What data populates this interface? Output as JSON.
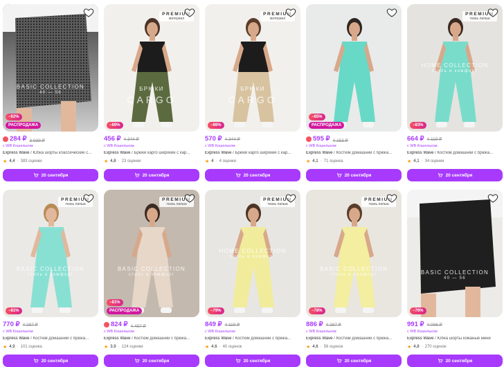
{
  "button_label": "20 сентября",
  "cards": [
    {
      "price": "284 ₽",
      "old": "3 939 ₽",
      "wallet": "с WB Кошельком",
      "brand": "Express Wave",
      "sep": " / ",
      "title": "Юбка шорты классические с...",
      "rating": "4,4",
      "reviews": "383 оценки",
      "discount": "−92%",
      "sale": "РАСПРОДАЖА",
      "dot": true,
      "premium": null,
      "overlay": "BASIC COLLECTION",
      "overlay2": "40 — 56",
      "big": null
    },
    {
      "price": "456 ₽",
      "old": "4 344 ₽",
      "wallet": "с WB Кошельком",
      "brand": "Express Wave",
      "sep": " / ",
      "title": "Брюки карго широкие с кар...",
      "rating": "4,8",
      "reviews": "23 оценки",
      "discount": "−89%",
      "sale": null,
      "dot": false,
      "premium": {
        "l1": "PREMIUM",
        "l2": "материал"
      },
      "overlay": "БРЮКИ",
      "overlay2": null,
      "big": "CARGO"
    },
    {
      "price": "570 ₽",
      "old": "4 344 ₽",
      "wallet": "с WB Кошельком",
      "brand": "Express Wave",
      "sep": " / ",
      "title": "Брюки карго широкие с кар...",
      "rating": "4",
      "reviews": "4 оценки",
      "discount": "−86%",
      "sale": null,
      "dot": false,
      "premium": {
        "l1": "PREMIUM",
        "l2": "материал"
      },
      "overlay": "БРЮКИ",
      "overlay2": null,
      "big": "CARGO"
    },
    {
      "price": "595 ₽",
      "old": "4 153 ₽",
      "wallet": "с WB Кошельком",
      "brand": "Express Wave",
      "sep": " / ",
      "title": "Костюм домашний с брюка...",
      "rating": "4,1",
      "reviews": "71 оценка",
      "discount": "−85%",
      "sale": "РАСПРОДАЖА",
      "dot": true,
      "premium": null,
      "overlay": null,
      "overlay2": null,
      "big": null
    },
    {
      "price": "664 ₽",
      "old": "4 119 ₽",
      "wallet": "с WB Кошельком",
      "brand": "Express Wave",
      "sep": " / ",
      "title": "Костюм домашний с брюка...",
      "rating": "4,1",
      "reviews": "34 оценки",
      "discount": "−83%",
      "sale": null,
      "dot": false,
      "premium": {
        "l1": "PREMIUM",
        "l2": "ткань лапша"
      },
      "overlay": "HOME COLLECTION",
      "overlay2": "стиль и комфорт",
      "big": null
    },
    {
      "price": "770 ₽",
      "old": "4 287 ₽",
      "wallet": "с WB Кошельком",
      "brand": "Express Wave",
      "sep": " / ",
      "title": "Костюм домашний с брюка...",
      "rating": "4,9",
      "reviews": "101 оценка",
      "discount": "−81%",
      "sale": null,
      "dot": false,
      "premium": {
        "l1": "PREMIUM",
        "l2": "ткань лапша"
      },
      "overlay": "BASIC COLLECTION",
      "overlay2": "стиль и комфорт",
      "big": null
    },
    {
      "price": "824 ₽",
      "old": "4 497 ₽",
      "wallet": "с WB Кошельком",
      "brand": "Express Wave",
      "sep": " / ",
      "title": "Костюм домашний с брюка...",
      "rating": "3,9",
      "reviews": "124 оценки",
      "discount": "−81%",
      "sale": "РАСПРОДАЖА",
      "dot": true,
      "premium": {
        "l1": "PREMIUM",
        "l2": "ткань лапша"
      },
      "overlay": "BASIC COLLECTION",
      "overlay2": "стиль и комфорт",
      "big": null
    },
    {
      "price": "849 ₽",
      "old": "4 119 ₽",
      "wallet": "с WB Кошельком",
      "brand": "Express Wave",
      "sep": " / ",
      "title": "Костюм домашний с брюка...",
      "rating": "4,6",
      "reviews": "40 оценок",
      "discount": "−79%",
      "sale": null,
      "dot": false,
      "premium": {
        "l1": "PREMIUM",
        "l2": "ткань лапша"
      },
      "overlay": "HOME COLLECTION",
      "overlay2": "стиль и комфорт",
      "big": null
    },
    {
      "price": "886 ₽",
      "old": "4 287 ₽",
      "wallet": "с WB Кошельком",
      "brand": "Express Wave",
      "sep": " / ",
      "title": "Костюм домашний с брюка...",
      "rating": "4,6",
      "reviews": "56 оценок",
      "discount": "−78%",
      "sale": null,
      "dot": false,
      "premium": {
        "l1": "PREMIUM",
        "l2": "ткань лапша"
      },
      "overlay": "BASIC COLLECTION",
      "overlay2": "стиль и комфорт",
      "big": null
    },
    {
      "price": "991 ₽",
      "old": "4 096 ₽",
      "wallet": "с WB Кошельком",
      "brand": "Express Wave",
      "sep": " / ",
      "title": "Юбка шорты кожаные мини",
      "rating": "4,8",
      "reviews": "270 оценок",
      "discount": "−76%",
      "sale": null,
      "dot": false,
      "premium": null,
      "overlay": "BASIC COLLECTION",
      "overlay2": "40 — 56",
      "big": null
    }
  ],
  "theme": {
    "accent": "#a73afd",
    "star": "#ff9a00",
    "discount": "#f64e60",
    "sale": "#d0189e"
  },
  "icons": {
    "heart": "heart-icon",
    "cart": "cart-icon",
    "star": "star-icon"
  }
}
